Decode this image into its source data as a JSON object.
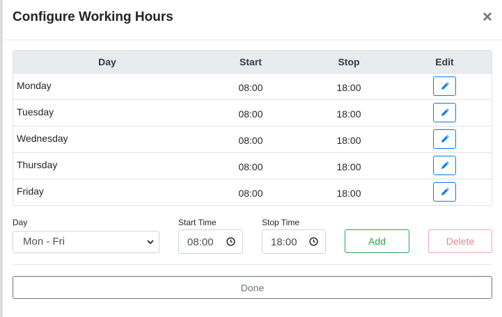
{
  "modal": {
    "title": "Configure Working Hours",
    "close_glyph": "×"
  },
  "table": {
    "headers": {
      "day": "Day",
      "start": "Start",
      "stop": "Stop",
      "edit": "Edit"
    },
    "rows": [
      {
        "day": "Monday",
        "start": "08:00",
        "stop": "18:00"
      },
      {
        "day": "Tuesday",
        "start": "08:00",
        "stop": "18:00"
      },
      {
        "day": "Wednesday",
        "start": "08:00",
        "stop": "18:00"
      },
      {
        "day": "Thursday",
        "start": "08:00",
        "stop": "18:00"
      },
      {
        "day": "Friday",
        "start": "08:00",
        "stop": "18:00"
      }
    ]
  },
  "form": {
    "day_label": "Day",
    "day_value": "Mon - Fri",
    "start_label": "Start Time",
    "start_value": "08:00",
    "stop_label": "Stop Time",
    "stop_value": "18:00",
    "add_label": "Add",
    "delete_label": "Delete"
  },
  "footer": {
    "done_label": "Done"
  },
  "colors": {
    "primary": "#007bff",
    "success": "#28a745",
    "danger": "#dc3545",
    "secondary": "#6c757d"
  },
  "icons": {
    "edit": "pencil-icon",
    "clock": "clock-icon",
    "select": "chevron-down-icon",
    "close": "close-icon"
  }
}
